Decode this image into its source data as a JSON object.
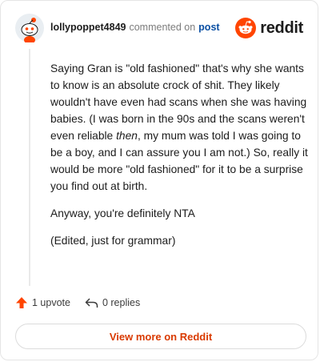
{
  "header": {
    "username": "lollypoppet4849",
    "action_text": "commented on",
    "post_link": "post",
    "logo_text": "reddit"
  },
  "comment": {
    "p1_before": "Saying Gran is \"old fashioned\" that's why she wants to know is an absolute crock of shit. They likely wouldn't have even had scans when she was having babies. (I was born in the 90s and the scans weren't even reliable ",
    "p1_em": "then",
    "p1_after": ", my mum was told I was going to be a boy, and I can assure you I am not.) So, really it would be more \"old fashioned\" for it to be a surprise you find out at birth.",
    "p2": "Anyway, you're definitely NTA",
    "p3": "(Edited, just for grammar)"
  },
  "actions": {
    "upvotes": "1 upvote",
    "replies": "0 replies"
  },
  "footer": {
    "view_more": "View more on Reddit"
  },
  "colors": {
    "brand": "#ff4500",
    "link": "#0a4fa3",
    "cta": "#d93a00"
  }
}
